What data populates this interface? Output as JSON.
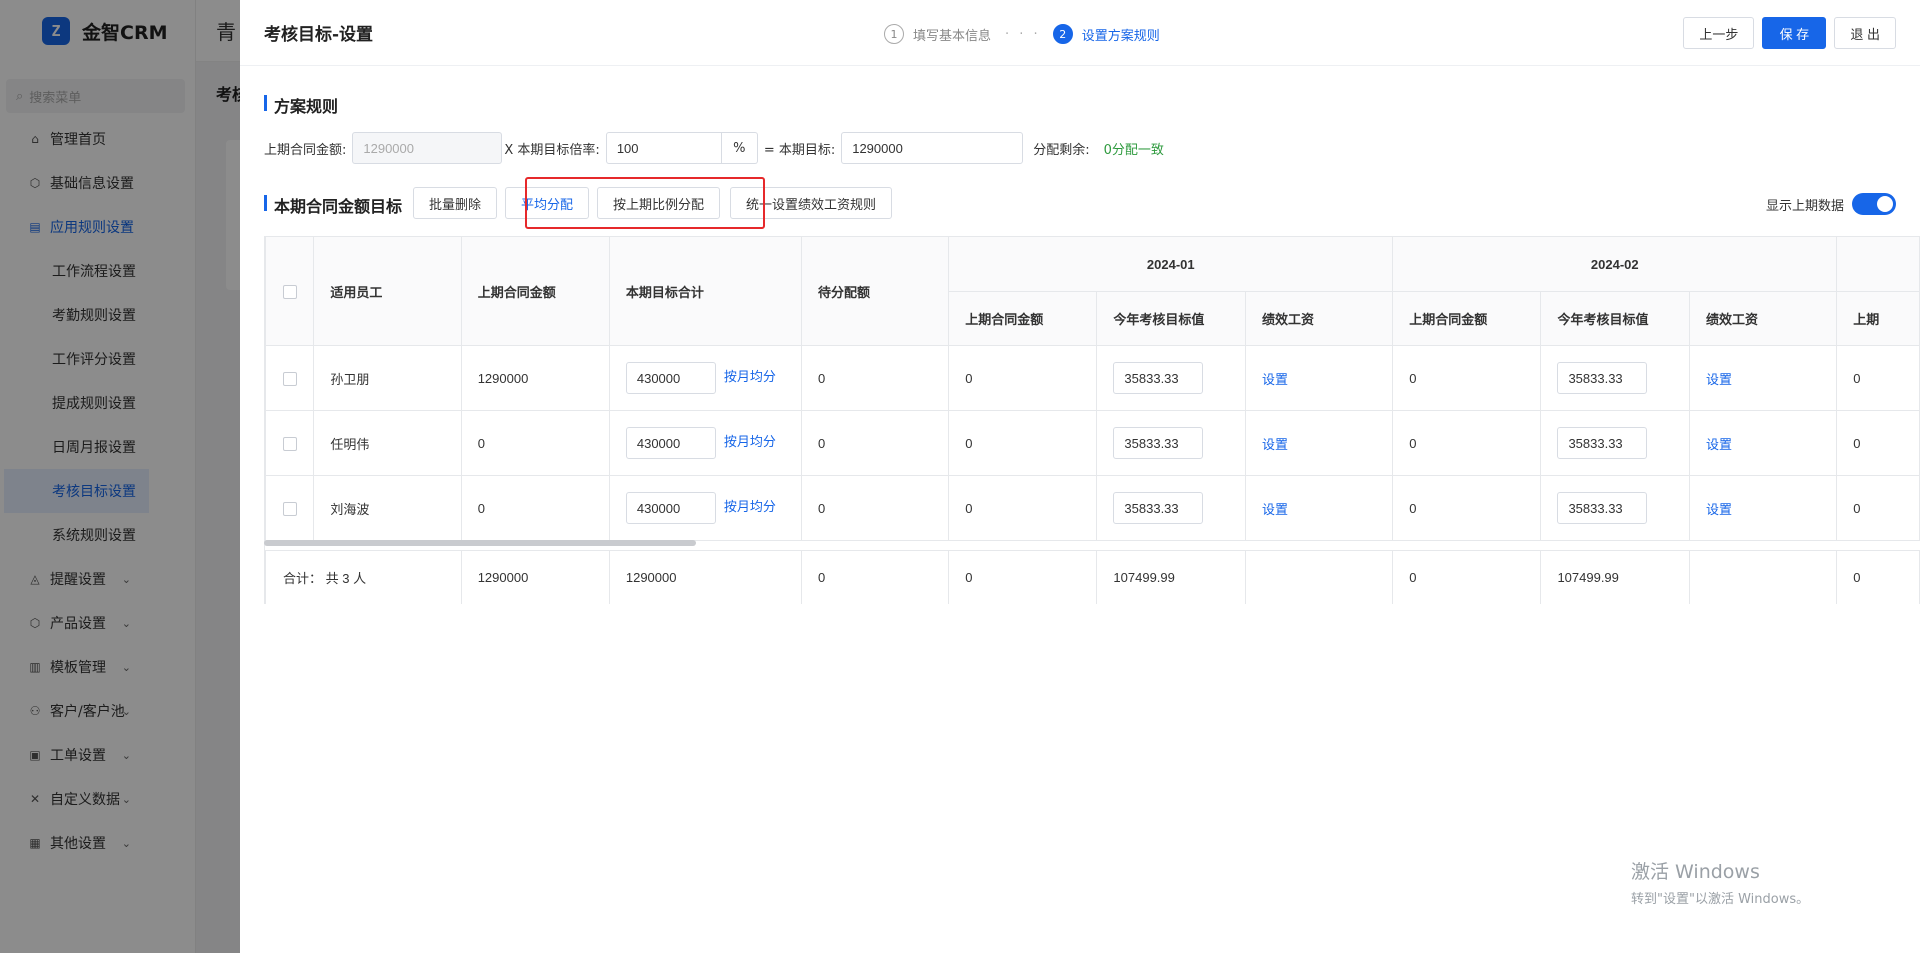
{
  "app": {
    "logo_mark": "Z",
    "logo_text": "金智CRM",
    "bg_tab": "青",
    "bg_crumb": "考核",
    "search_placeholder": "搜索菜单",
    "menu": [
      {
        "label": "管理首页",
        "icon": "home-icon",
        "glyph": "⌂",
        "chevron": ""
      },
      {
        "label": "基础信息设置",
        "icon": "cube-icon",
        "glyph": "⬡",
        "chevron": "⌄"
      },
      {
        "label": "应用规则设置",
        "icon": "doc-icon",
        "glyph": "▤",
        "chevron": "⌃"
      }
    ],
    "submenu": [
      "工作流程设置",
      "考勤规则设置",
      "工作评分设置",
      "提成规则设置",
      "日周月报设置",
      "考核目标设置",
      "系统规则设置"
    ],
    "menu_after": [
      {
        "label": "提醒设置",
        "icon": "bell-icon",
        "glyph": "◬"
      },
      {
        "label": "产品设置",
        "icon": "cube-icon",
        "glyph": "⬡"
      },
      {
        "label": "模板管理",
        "icon": "template-icon",
        "glyph": "▥"
      },
      {
        "label": "客户/客户池",
        "icon": "customer-icon",
        "glyph": "⚇"
      },
      {
        "label": "工单设置",
        "icon": "ticket-icon",
        "glyph": "▣"
      },
      {
        "label": "自定义数据",
        "icon": "tools-icon",
        "glyph": "✕"
      },
      {
        "label": "其他设置",
        "icon": "grid-icon",
        "glyph": "▦"
      }
    ],
    "chevron": "⌄"
  },
  "drawer": {
    "title": "考核目标-设置",
    "steps": [
      {
        "num": "1",
        "label": "填写基本信息"
      },
      {
        "num": "2",
        "label": "设置方案规则"
      }
    ],
    "step_dots": "· · ·",
    "prev_button": "上一步",
    "save_button": "保 存",
    "exit_button": "退 出"
  },
  "plan": {
    "section_title": "方案规则",
    "prev_amount_label": "上期合同金额:",
    "prev_amount_value": "1290000",
    "multiplier_label": "X 本期目标倍率:",
    "multiplier_value": "100",
    "multiplier_unit": "%",
    "target_label": "= 本期目标:",
    "target_value": "1290000",
    "remain_label": "分配剩余:",
    "remain_value": "0分配一致"
  },
  "target": {
    "section_title": "本期合同金额目标",
    "batch_delete": "批量删除",
    "avg_assign": "平均分配",
    "prop_assign": "按上期比例分配",
    "unified_rule": "统一设置绩效工资规则",
    "show_prev_label": "显示上期数据",
    "show_prev_on": true
  },
  "table": {
    "headers": {
      "employee": "适用员工",
      "prev_amount": "上期合同金额",
      "target_total": "本期目标合计",
      "pending": "待分配额"
    },
    "months": [
      "2024-01",
      "2024-02"
    ],
    "sub_headers": [
      "上期合同金额",
      "今年考核目标值",
      "绩效工资"
    ],
    "third_month_partial": "上期",
    "rows": [
      {
        "name": "孙卫朋",
        "prev": "1290000",
        "target": "430000",
        "split": "按月均分",
        "pending": "0",
        "m1_prev": "0",
        "m1_target": "35833.33",
        "m1_salary": "设置",
        "m2_prev": "0",
        "m2_target": "35833.33",
        "m2_salary": "设置",
        "m3_prev": "0"
      },
      {
        "name": "任明伟",
        "prev": "0",
        "target": "430000",
        "split": "按月均分",
        "pending": "0",
        "m1_prev": "0",
        "m1_target": "35833.33",
        "m1_salary": "设置",
        "m2_prev": "0",
        "m2_target": "35833.33",
        "m2_salary": "设置",
        "m3_prev": "0"
      },
      {
        "name": "刘海波",
        "prev": "0",
        "target": "430000",
        "split": "按月均分",
        "pending": "0",
        "m1_prev": "0",
        "m1_target": "35833.33",
        "m1_salary": "设置",
        "m2_prev": "0",
        "m2_target": "35833.33",
        "m2_salary": "设置",
        "m3_prev": "0"
      }
    ],
    "total": {
      "label": "合计：  共 3 人",
      "prev": "1290000",
      "target": "1290000",
      "pending": "0",
      "m1_prev": "0",
      "m1_target": "107499.99",
      "m2_prev": "0",
      "m2_target": "107499.99",
      "m3_prev": "0"
    }
  },
  "watermark": {
    "line1": "激活 Windows",
    "line2": "转到\"设置\"以激活 Windows。"
  },
  "colors": {
    "accent": "#1766e8",
    "highlight_border": "#e6292b",
    "success": "#2e9a3e"
  }
}
